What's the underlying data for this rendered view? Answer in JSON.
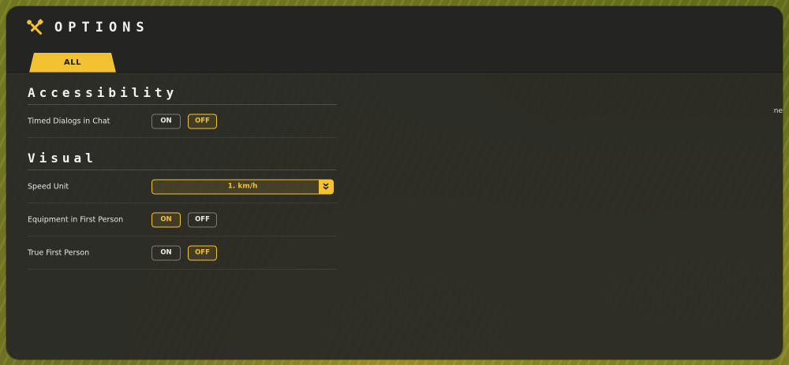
{
  "header": {
    "title": "OPTIONS",
    "icon": "tools-icon"
  },
  "tabs": [
    {
      "label": "ALL",
      "active": true
    }
  ],
  "sections": [
    {
      "title": "Accessibility",
      "rows": [
        {
          "label": "Timed Dialogs in Chat",
          "type": "toggle",
          "on_label": "ON",
          "off_label": "OFF",
          "value": "OFF"
        }
      ]
    },
    {
      "title": "Visual",
      "rows": [
        {
          "label": "Speed Unit",
          "type": "dropdown",
          "value": "1. km/h"
        },
        {
          "label": "Equipment in First Person",
          "type": "toggle",
          "on_label": "ON",
          "off_label": "OFF",
          "value": "ON"
        },
        {
          "label": "True First Person",
          "type": "toggle",
          "on_label": "ON",
          "off_label": "OFF",
          "value": "OFF"
        }
      ]
    }
  ],
  "colors": {
    "accent": "#f3c233",
    "panel": "#282826",
    "text": "#f2f2f2"
  }
}
